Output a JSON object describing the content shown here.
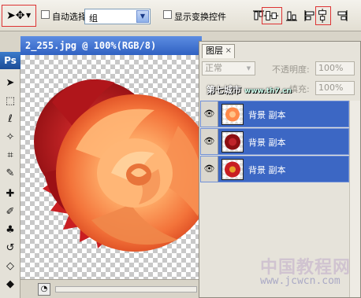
{
  "options_bar": {
    "auto_select_label": "自动选择:",
    "auto_select_value": "组",
    "show_transform_label": "显示变换控件"
  },
  "toolbox": {
    "logo": "Ps",
    "tools": [
      "move-tool-icon",
      "marquee-tool-icon",
      "lasso-tool-icon",
      "magic-wand-icon",
      "crop-tool-icon",
      "slice-tool-icon",
      "healing-brush-icon",
      "brush-tool-icon",
      "clone-stamp-icon",
      "history-brush-icon",
      "eraser-tool-icon",
      "paint-bucket-icon"
    ]
  },
  "document": {
    "title": "2_255.jpg @ 100%(RGB/8)"
  },
  "layers_panel": {
    "tab_label": "图层",
    "blend_mode": "正常",
    "opacity_label": "不透明度:",
    "opacity_value": "100%",
    "fill_label": "填充:",
    "fill_value": "100%",
    "layers": [
      {
        "name": "背景 副本",
        "thumb_color": "#ff8a4a"
      },
      {
        "name": "背景 副本",
        "thumb_color": "#8b0f12"
      },
      {
        "name": "背景 副本",
        "thumb_color": "#c81e22"
      }
    ]
  },
  "watermarks": {
    "top_text": "第七城市",
    "top_url": "www.th7.cn",
    "bottom_text": "中国教程网",
    "bottom_url": "www.jcwcn.com"
  },
  "colors": {
    "selected_layer": "#3c67c4",
    "title_bar": "#2f61c2",
    "highlight_border": "#dd3333"
  }
}
